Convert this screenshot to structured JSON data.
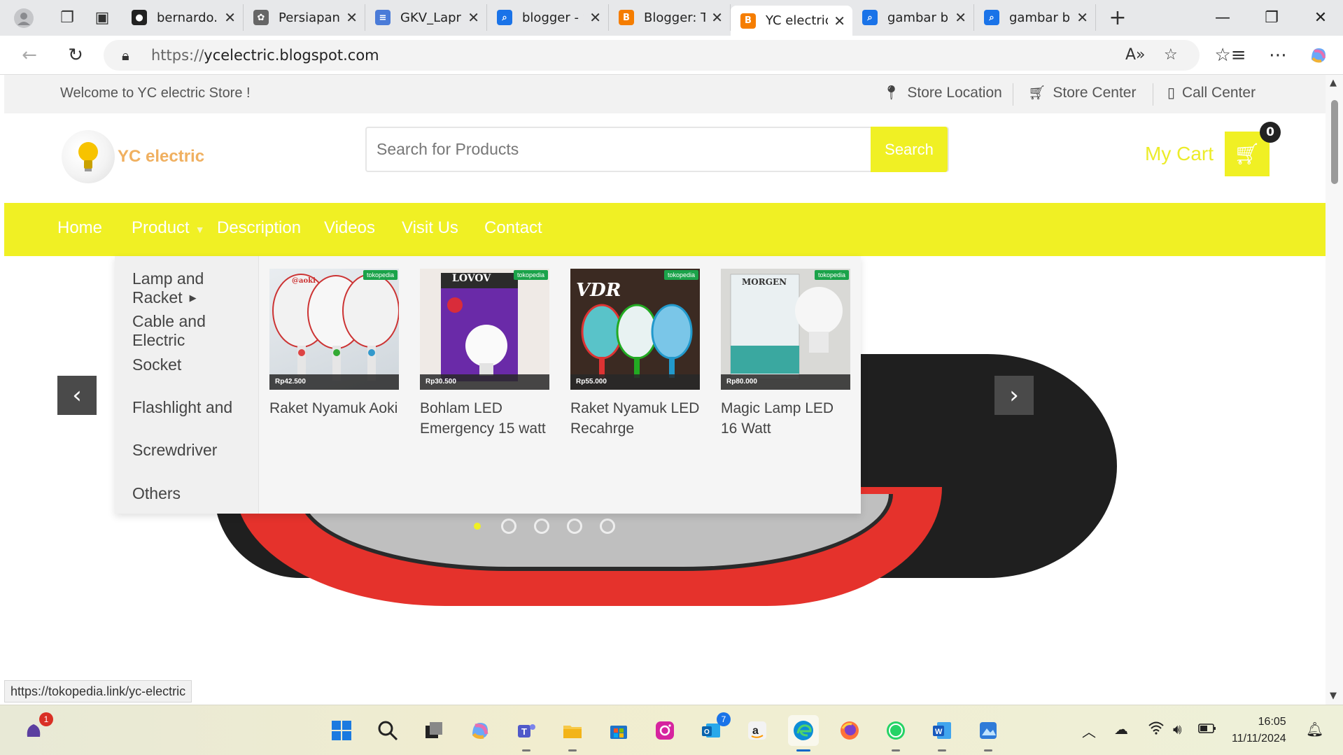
{
  "browser": {
    "tabs": [
      {
        "label": "bernardo.g",
        "favicon": "github-icon",
        "color": "#222"
      },
      {
        "label": "Persiapan I",
        "favicon": "chatgpt-icon",
        "color": "#666"
      },
      {
        "label": "GKV_Lapra",
        "favicon": "docs-icon",
        "color": "#4a7bd8"
      },
      {
        "label": "blogger - S",
        "favicon": "search-icon",
        "color": "#1a73e8"
      },
      {
        "label": "Blogger: Ta",
        "favicon": "blogger-icon",
        "color": "#f57d00"
      },
      {
        "label": "YC electric",
        "favicon": "blogger-icon",
        "color": "#f57d00",
        "active": true
      },
      {
        "label": "gambar bl",
        "favicon": "search-icon",
        "color": "#1a73e8"
      },
      {
        "label": "gambar bl",
        "favicon": "search-icon",
        "color": "#1a73e8"
      }
    ],
    "url_protocol": "https://",
    "url_host": "ycelectric.blogspot.com",
    "status_url": "https://tokopedia.link/yc-electric"
  },
  "site": {
    "welcome": "Welcome to YC electric Store !",
    "top_links": {
      "store_location": "Store Location",
      "store_center": "Store Center",
      "call_center": "Call Center"
    },
    "brand": "YC electric",
    "search": {
      "placeholder": "Search for Products",
      "button": "Search"
    },
    "cart": {
      "label": "My Cart",
      "count": "0"
    },
    "menu": {
      "home": "Home",
      "product": "Product",
      "description": "Description",
      "videos": "Videos",
      "visit_us": "Visit Us",
      "contact": "Contact"
    },
    "dropdown": {
      "categories": [
        "Lamp and Racket",
        "Cable and Electric",
        "Socket",
        "Flashlight and",
        "Screwdriver",
        "Others"
      ],
      "products": [
        {
          "name": "Raket Nyamuk Aoki",
          "price": "Rp42.500",
          "tag": "tokopedia",
          "brand_text": "@aoki"
        },
        {
          "name": "Bohlam LED Emergency 15 watt",
          "price": "Rp30.500",
          "tag": "tokopedia",
          "brand_text": "LOVOV"
        },
        {
          "name": "Raket Nyamuk LED Recahrge",
          "price": "Rp55.000",
          "tag": "tokopedia",
          "brand_text": "VDR"
        },
        {
          "name": "Magic Lamp LED 16 Watt",
          "price": "Rp80.000",
          "tag": "tokopedia",
          "brand_text": "MORGEN"
        }
      ]
    },
    "colors": {
      "accent": "#f0f024",
      "cart_text": "#ecec2a"
    }
  },
  "taskbar": {
    "badges": {
      "start_notifications": "1",
      "outlook_count": "7"
    },
    "clock_time": "16:05",
    "clock_date": "11/11/2024"
  }
}
